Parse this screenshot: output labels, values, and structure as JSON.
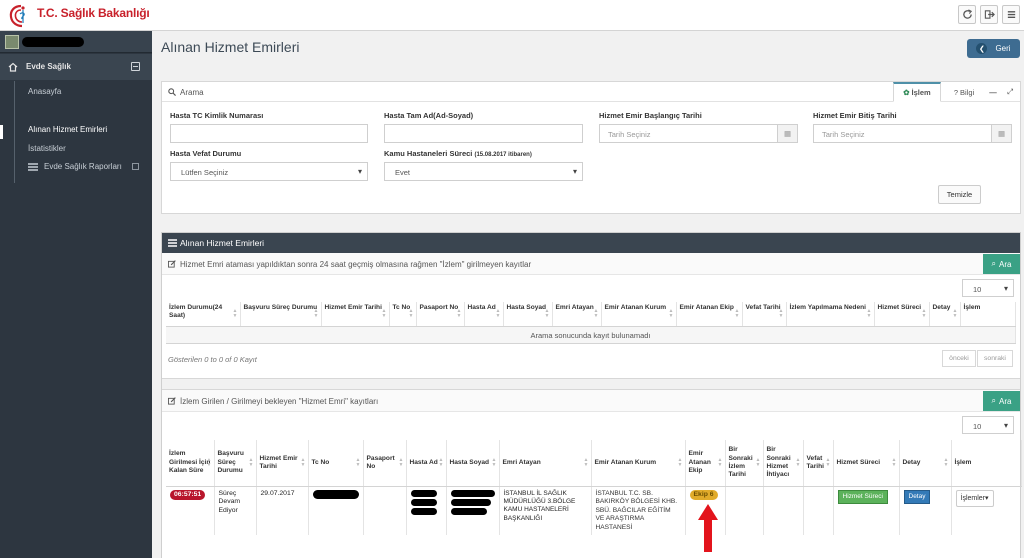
{
  "app": {
    "logo_text": "T.C. Sağlık Bakanlığı",
    "colors": {
      "brand_red": "#c8212b",
      "sidebar": "#2d3640",
      "accent_teal": "#3aa185",
      "back_button": "#3e6c91"
    }
  },
  "topbar": {
    "icons": [
      "refresh-icon",
      "sign-out-icon",
      "menu-icon"
    ]
  },
  "sidebar": {
    "section_label": "Evde Sağlık",
    "items": [
      {
        "label": "Anasayfa",
        "active": false
      },
      {
        "label": "Alınan Hizmet Emirleri",
        "active": true
      },
      {
        "label": "İstatistikler",
        "active": false
      },
      {
        "label": "Evde Sağlık Raporları",
        "active": false
      }
    ]
  },
  "page": {
    "title": "Alınan Hizmet Emirleri",
    "back_label": "Geri"
  },
  "search_panel": {
    "title": "Arama",
    "tab_islem": "İşlem",
    "tab_bilgi": "Bilgi",
    "fields": {
      "tc_label": "Hasta TC Kimlik Numarası",
      "tc_value": "",
      "name_label": "Hasta Tam Ad(Ad-Soyad)",
      "name_value": "",
      "start_label": "Hizmet Emir Başlangıç Tarihi",
      "start_placeholder": "Tarih Seçiniz",
      "end_label": "Hizmet Emir Bitiş Tarihi",
      "end_placeholder": "Tarih Seçiniz",
      "vefat_label": "Hasta Vefat Durumu",
      "vefat_value": "Lütfen Seçiniz",
      "kamu_label": "Kamu Hastaneleri Süreci",
      "kamu_note": "(15.08.2017 itibaren)",
      "kamu_value": "Evet"
    },
    "clear_label": "Temizle"
  },
  "orders_panel": {
    "title": "Alınan Hizmet Emirleri",
    "section1": {
      "title": "Hizmet Emri ataması yapıldıktan sonra 24 saat geçmiş olmasına rağmen \"İzlem\" girilmeyen kayıtlar",
      "search_label": "Ara",
      "page_size": "10",
      "headers": [
        "İzlem Durumu(24 Saat)",
        "Başvuru Süreç Durumu",
        "Hizmet Emir Tarihi",
        "Tc No",
        "Pasaport No",
        "Hasta Ad",
        "Hasta Soyad",
        "Emri Atayan",
        "Emir Atanan Kurum",
        "Emir Atanan Ekip",
        "Vefat Tarihi",
        "İzlem Yapılmama Nedeni",
        "Hizmet Süreci",
        "Detay",
        "İşlem"
      ],
      "empty_message": "Arama sonucunda kayıt bulunamadı",
      "info": "Gösterilen 0 to 0 of 0 Kayıt",
      "prev_label": "önceki",
      "next_label": "sonraki"
    },
    "section2": {
      "title": "İzlem Girilen / Girilmeyi bekleyen \"Hizmet Emri\" kayıtları",
      "search_label": "Ara",
      "page_size": "10",
      "headers": [
        "İzlem Girilmesi İçin Kalan Süre",
        "Başvuru Süreç Durumu",
        "Hizmet Emir Tarihi",
        "Tc No",
        "Pasaport No",
        "Hasta Ad",
        "Hasta Soyad",
        "Emri Atayan",
        "Emir Atanan Kurum",
        "Emir Atanan Ekip",
        "Bir Sonraki İzlem Tarihi",
        "Bir Sonraki Hizmet İhtiyacı",
        "Vefat Tarihi",
        "Hizmet Süreci",
        "Detay",
        "İşlem"
      ],
      "row": {
        "remaining": "06:57:51",
        "status": "Süreç Devam Ediyor",
        "date": "29.07.2017",
        "assigner": "İSTANBUL İL SAĞLIK MÜDÜRLÜĞÜ 3.BÖLGE KAMU HASTANELERİ BAŞKANLIĞI",
        "institution": "İSTANBUL T.C. SB. BAKIRKÖY BÖLGESİ KHB. SBÜ. BAĞCILAR EĞİTİM VE ARAŞTIRMA HASTANESİ",
        "team": "Ekip 6",
        "process_btn": "Hizmet Süreci",
        "detail_btn": "Detay",
        "ops_btn": "İşlemler"
      }
    }
  }
}
